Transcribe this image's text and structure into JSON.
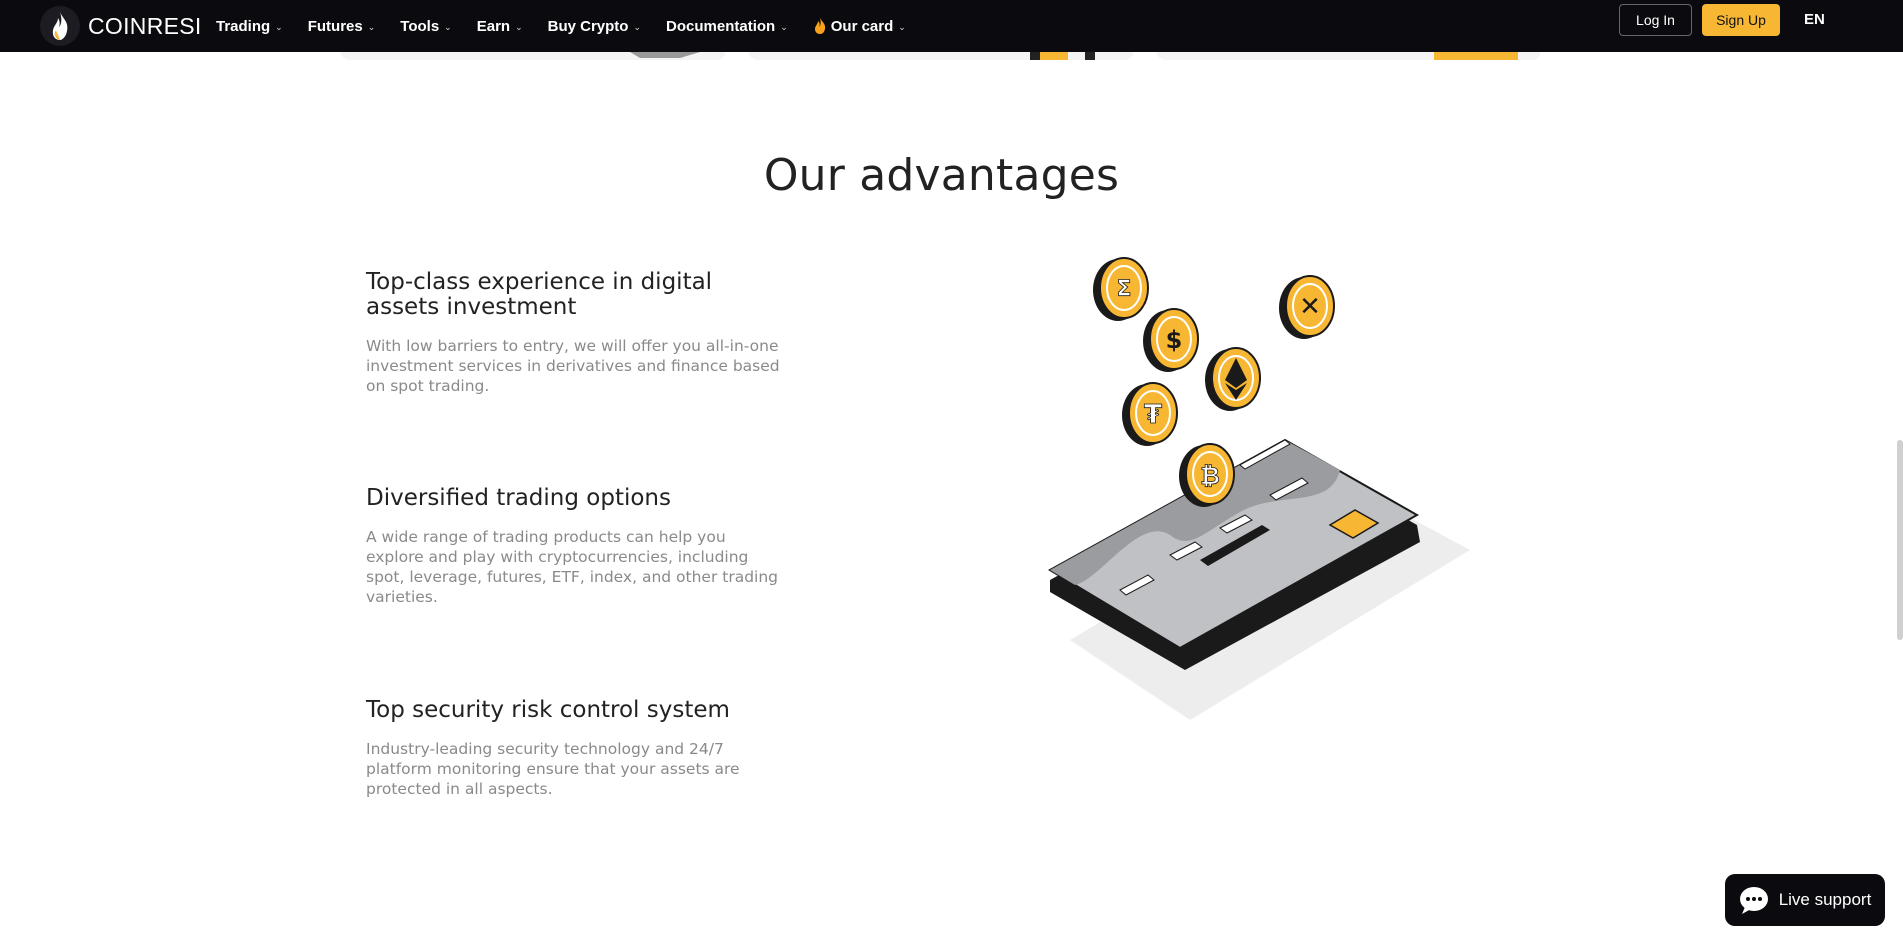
{
  "brand": {
    "name": "COINRESI"
  },
  "nav": {
    "items": [
      {
        "label": "Trading"
      },
      {
        "label": "Futures"
      },
      {
        "label": "Tools"
      },
      {
        "label": "Earn"
      },
      {
        "label": "Buy Crypto"
      },
      {
        "label": "Documentation"
      },
      {
        "label": "Our card"
      }
    ],
    "login_label": "Log In",
    "signup_label": "Sign Up",
    "language": "EN"
  },
  "advantages": {
    "title": "Our advantages",
    "items": [
      {
        "title": "Top-class experience in digital assets investment",
        "text": "With low barriers to entry, we will offer you all-in-one investment services in derivatives and finance based on spot trading."
      },
      {
        "title": "Diversified trading options",
        "text": "A wide range of trading products can help you explore and play with cryptocurrencies, including spot, leverage, futures, ETF, index, and other trading varieties."
      },
      {
        "title": "Top security risk control system",
        "text": "Industry-leading security technology and 24/7 platform monitoring ensure that your assets are protected in all aspects."
      }
    ]
  },
  "support": {
    "label": "Live support"
  },
  "colors": {
    "accent": "#f7b733",
    "nav_bg": "#0b0b0f"
  }
}
